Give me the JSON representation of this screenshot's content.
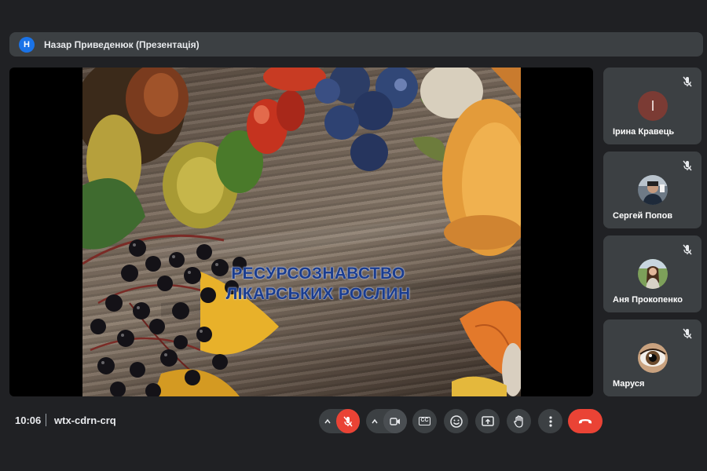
{
  "presenter": {
    "initial": "Н",
    "title": "Назар Приведенюк (Презентація)"
  },
  "slide": {
    "title_line1": "РЕСУРСОЗНАВСТВО",
    "title_line2": "ЛІКАРСЬКИХ РОСЛИН"
  },
  "participants": [
    {
      "name": "Ірина Кравець",
      "initial": "І",
      "avatar": "letter",
      "muted": true
    },
    {
      "name": "Сергей Попов",
      "avatar": "photo-man-dark",
      "muted": true
    },
    {
      "name": "Аня Прокопенко",
      "avatar": "photo-woman-outdoor",
      "muted": true
    },
    {
      "name": "Маруся",
      "avatar": "photo-eye",
      "muted": true
    }
  ],
  "meeting": {
    "time": "10:06",
    "code": "wtx-cdrn-crq"
  },
  "controls": {
    "mic": {
      "icon": "mic-off-icon",
      "state": "muted",
      "color": "#ea4335"
    },
    "camera": {
      "icon": "camera-icon"
    },
    "captions": {
      "icon": "cc-icon",
      "label": "CC"
    },
    "reactions": {
      "icon": "emoji-icon"
    },
    "present": {
      "icon": "present-screen-icon"
    },
    "raise_hand": {
      "icon": "hand-icon"
    },
    "more": {
      "icon": "more-vert-icon"
    },
    "leave": {
      "icon": "end-call-icon",
      "color": "#ea4335"
    }
  },
  "colors": {
    "background": "#202124",
    "surface": "#3c4043",
    "danger": "#ea4335",
    "accent": "#1a73e8"
  }
}
